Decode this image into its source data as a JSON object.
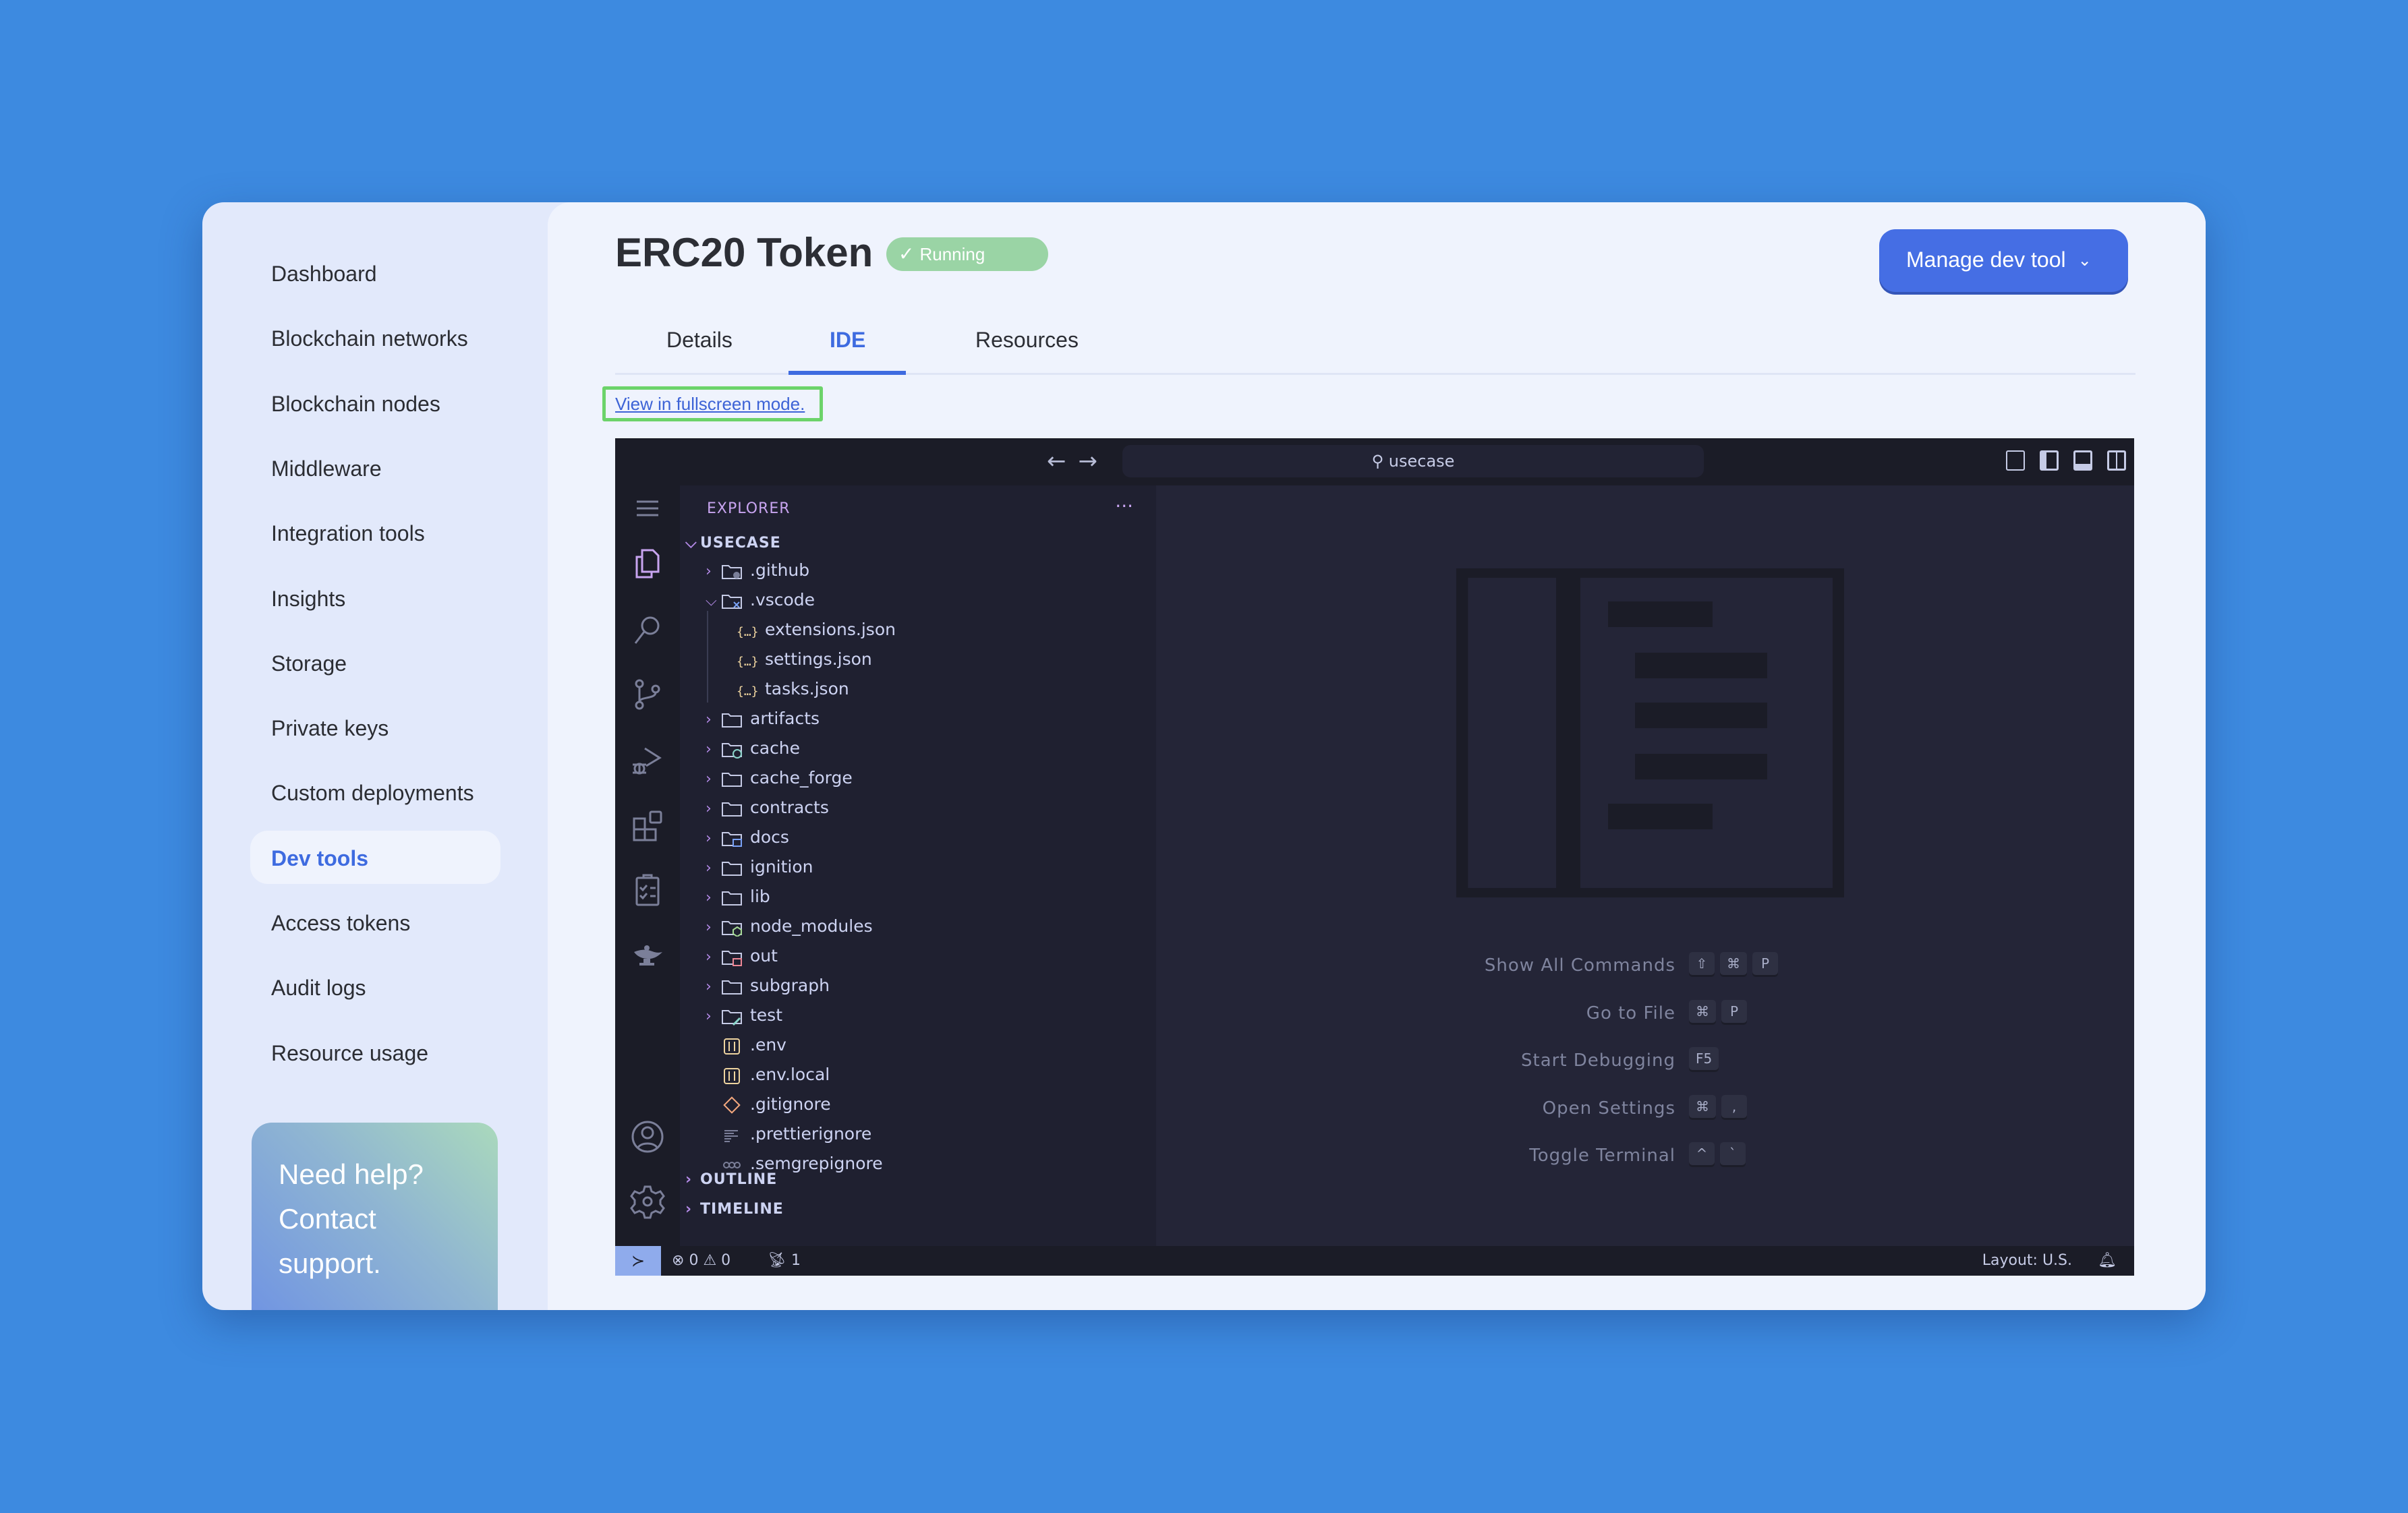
{
  "sidebar": {
    "items": [
      {
        "label": "Dashboard"
      },
      {
        "label": "Blockchain networks"
      },
      {
        "label": "Blockchain nodes"
      },
      {
        "label": "Middleware"
      },
      {
        "label": "Integration tools"
      },
      {
        "label": "Insights"
      },
      {
        "label": "Storage"
      },
      {
        "label": "Private keys"
      },
      {
        "label": "Custom deployments"
      },
      {
        "label": "Dev tools",
        "active": true
      },
      {
        "label": "Access tokens"
      },
      {
        "label": "Audit logs"
      },
      {
        "label": "Resource usage"
      }
    ],
    "help": {
      "line1": "Need help?",
      "line2": "Contact",
      "line3": "support."
    }
  },
  "header": {
    "title": "ERC20 Token",
    "status": "Running",
    "status_icon": "check-icon",
    "manage_button": "Manage dev tool",
    "colors": {
      "accent": "#456ee4",
      "status": "#9ad4a5",
      "highlight_border": "#6cd36a"
    }
  },
  "tabs": [
    {
      "label": "Details"
    },
    {
      "label": "IDE",
      "active": true
    },
    {
      "label": "Resources"
    }
  ],
  "fullscreen_link": "View in fullscreen mode.",
  "ide": {
    "search_text": "usecase",
    "explorer_title": "EXPLORER",
    "more_actions": "···",
    "workspace": "USECASE",
    "tree": [
      {
        "name": ".github",
        "type": "folder",
        "icon": "folder-github-icon",
        "expanded": false,
        "depth": 1
      },
      {
        "name": ".vscode",
        "type": "folder",
        "icon": "folder-vscode-icon",
        "expanded": true,
        "depth": 1
      },
      {
        "name": "extensions.json",
        "type": "file",
        "icon": "json-icon",
        "depth": 2
      },
      {
        "name": "settings.json",
        "type": "file",
        "icon": "json-icon",
        "depth": 2
      },
      {
        "name": "tasks.json",
        "type": "file",
        "icon": "json-icon",
        "depth": 2
      },
      {
        "name": "artifacts",
        "type": "folder",
        "icon": "folder-icon",
        "expanded": false,
        "depth": 1
      },
      {
        "name": "cache",
        "type": "folder",
        "icon": "folder-cache-icon",
        "expanded": false,
        "depth": 1
      },
      {
        "name": "cache_forge",
        "type": "folder",
        "icon": "folder-icon",
        "expanded": false,
        "depth": 1
      },
      {
        "name": "contracts",
        "type": "folder",
        "icon": "folder-icon",
        "expanded": false,
        "depth": 1
      },
      {
        "name": "docs",
        "type": "folder",
        "icon": "folder-docs-icon",
        "expanded": false,
        "depth": 1
      },
      {
        "name": "ignition",
        "type": "folder",
        "icon": "folder-icon",
        "expanded": false,
        "depth": 1
      },
      {
        "name": "lib",
        "type": "folder",
        "icon": "folder-icon",
        "expanded": false,
        "depth": 1
      },
      {
        "name": "node_modules",
        "type": "folder",
        "icon": "folder-node-icon",
        "expanded": false,
        "depth": 1
      },
      {
        "name": "out",
        "type": "folder",
        "icon": "folder-out-icon",
        "expanded": false,
        "depth": 1
      },
      {
        "name": "subgraph",
        "type": "folder",
        "icon": "folder-icon",
        "expanded": false,
        "depth": 1
      },
      {
        "name": "test",
        "type": "folder",
        "icon": "folder-test-icon",
        "expanded": false,
        "depth": 1
      },
      {
        "name": ".env",
        "type": "file",
        "icon": "env-icon",
        "depth": 1
      },
      {
        "name": ".env.local",
        "type": "file",
        "icon": "env-icon",
        "depth": 1
      },
      {
        "name": ".gitignore",
        "type": "file",
        "icon": "git-icon",
        "depth": 1
      },
      {
        "name": ".prettierignore",
        "type": "file",
        "icon": "prettier-icon",
        "depth": 1
      },
      {
        "name": ".semgrepignore",
        "type": "file",
        "icon": "semgrep-icon",
        "depth": 1
      }
    ],
    "sections": [
      {
        "label": "OUTLINE"
      },
      {
        "label": "TIMELINE"
      }
    ],
    "shortcuts": [
      {
        "label": "Show All Commands",
        "keys": [
          "⇧",
          "⌘",
          "P"
        ]
      },
      {
        "label": "Go to File",
        "keys": [
          "⌘",
          "P"
        ]
      },
      {
        "label": "Start Debugging",
        "keys": [
          "F5"
        ]
      },
      {
        "label": "Open Settings",
        "keys": [
          "⌘",
          ","
        ]
      },
      {
        "label": "Toggle Terminal",
        "keys": [
          "^",
          "`"
        ]
      }
    ],
    "status": {
      "errors": "0",
      "warnings": "0",
      "ports": "1",
      "layout": "Layout: U.S."
    }
  }
}
